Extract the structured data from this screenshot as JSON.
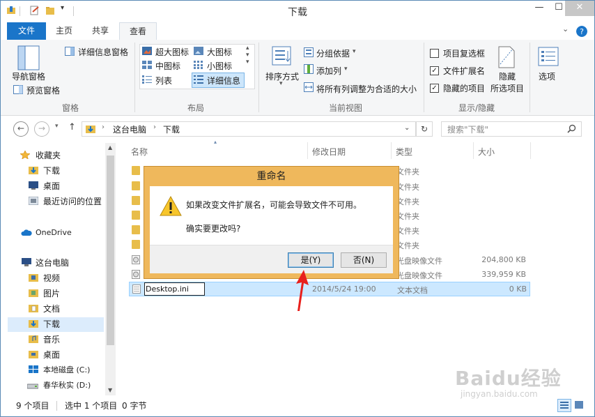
{
  "window": {
    "title": "下载",
    "minimize_glyph": "—",
    "maximize_glyph": "☐",
    "close_glyph": "✕"
  },
  "ribbon_tabs": [
    "文件",
    "主页",
    "共享",
    "查看"
  ],
  "ribbon": {
    "pane_group": {
      "nav_pane": "导航窗格",
      "preview_pane": "预览窗格",
      "details_pane": "详细信息窗格",
      "label": "窗格"
    },
    "layout_group": {
      "items": [
        "超大图标",
        "大图标",
        "中图标",
        "小图标",
        "列表",
        "详细信息"
      ],
      "label": "布局"
    },
    "current_view_group": {
      "sort": "排序方式",
      "group_by": "分组依据",
      "add_column": "添加列",
      "fit_columns": "将所有列调整为合适的大小",
      "label": "当前视图"
    },
    "show_hide_group": {
      "item_checkboxes": "项目复选框",
      "file_extensions": "文件扩展名",
      "hidden_items": "隐藏的项目",
      "hide_selected_1": "隐藏",
      "hide_selected_2": "所选项目",
      "label": "显示/隐藏"
    },
    "options": "选项"
  },
  "address": {
    "path": [
      "这台电脑",
      "下载"
    ],
    "search_placeholder": "搜索\"下载\""
  },
  "nav_pane": {
    "favorites": "收藏夹",
    "fav_items": [
      "下载",
      "桌面",
      "最近访问的位置"
    ],
    "onedrive": "OneDrive",
    "this_pc": "这台电脑",
    "pc_items": [
      "视频",
      "图片",
      "文档",
      "下载",
      "音乐",
      "桌面",
      "本地磁盘 (C:)",
      "春华秋实 (D:)"
    ]
  },
  "columns": [
    "名称",
    "修改日期",
    "类型",
    "大小"
  ],
  "files": [
    {
      "type": "文件夹",
      "size": ""
    },
    {
      "type": "文件夹",
      "size": ""
    },
    {
      "type": "文件夹",
      "size": ""
    },
    {
      "type": "文件夹",
      "size": ""
    },
    {
      "type": "文件夹",
      "size": ""
    },
    {
      "type": "文件夹",
      "size": ""
    },
    {
      "type": "光盘映像文件",
      "size": "204,800 KB"
    },
    {
      "type": "光盘映像文件",
      "size": "339,959 KB"
    }
  ],
  "rename_row": {
    "name": "Desktop.ini",
    "date": "2014/5/24 19:00",
    "type": "文本文档",
    "size": "0 KB"
  },
  "status": {
    "count": "9 个项目",
    "selected": "选中 1 个项目",
    "bytes": "0 字节"
  },
  "dialog": {
    "title": "重命名",
    "message": "如果改变文件扩展名，可能会导致文件不可用。",
    "question": "确实要更改吗?",
    "yes": "是(Y)",
    "no": "否(N)"
  },
  "watermark": {
    "brand": "Baidu经验",
    "url": "jingyan.baidu.com"
  },
  "colors": {
    "accent": "#1a75c9",
    "dialog_frame": "#efb85c",
    "selection": "#cce8ff",
    "arrow": "#e8201c"
  }
}
